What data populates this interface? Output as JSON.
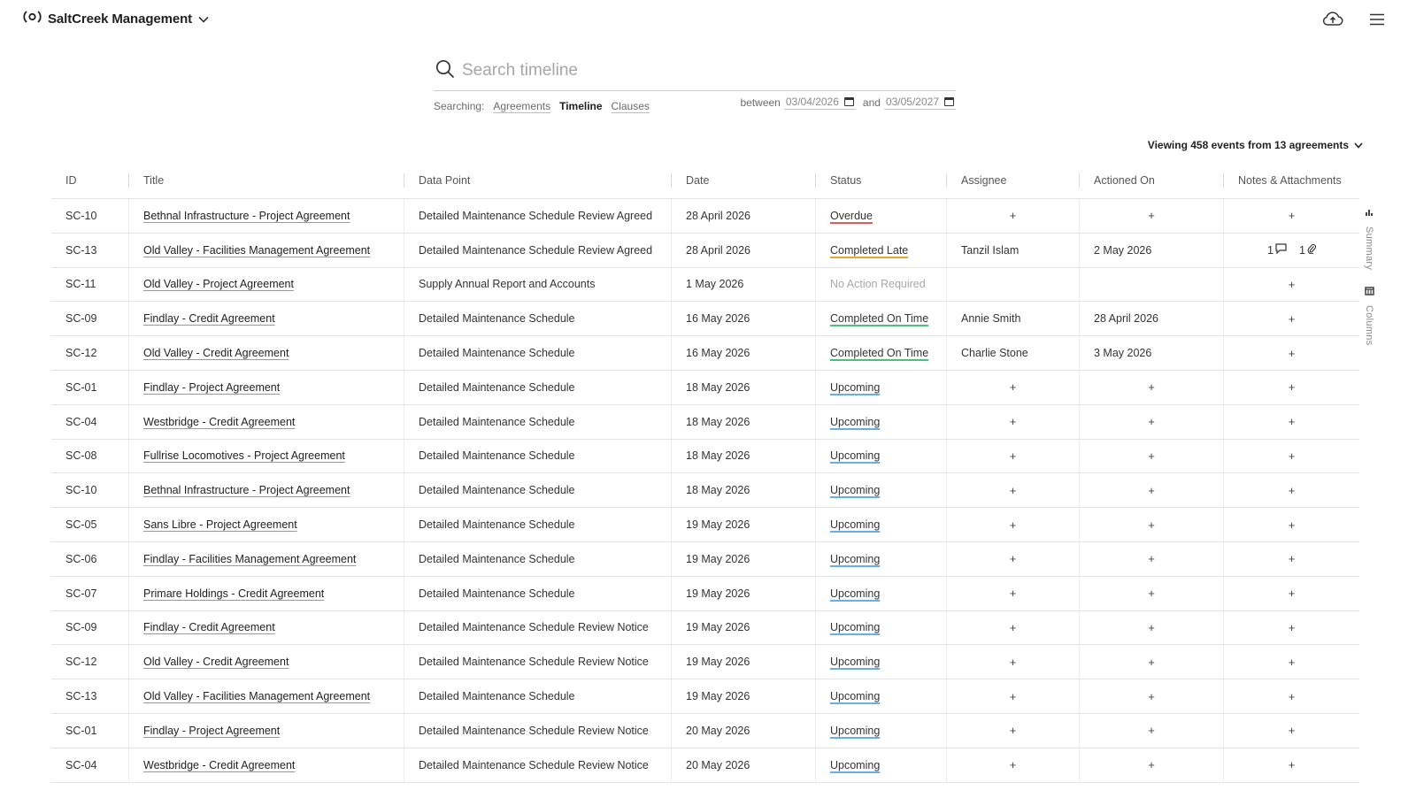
{
  "header": {
    "org_name": "SaltCreek Management",
    "icons": {
      "logo": "brand-logo-icon",
      "switch": "chevron-down-icon",
      "upload": "cloud-upload-icon",
      "menu": "hamburger-menu-icon"
    }
  },
  "search": {
    "placeholder": "Search timeline",
    "searching_label": "Searching:",
    "scopes": [
      "Agreements",
      "Timeline",
      "Clauses"
    ],
    "active_scope": "Timeline",
    "between_label": "between",
    "and_label": "and",
    "start_date": "03/04/2026",
    "end_date": "03/05/2027"
  },
  "summary": {
    "viewing_text": "Viewing 458 events from 13 agreements"
  },
  "table": {
    "columns": [
      "ID",
      "Title",
      "Data Point",
      "Date",
      "Status",
      "Assignee",
      "Actioned On",
      "Notes & Attachments"
    ],
    "rows": [
      {
        "id": "SC-10",
        "title": "Bethnal Infrastructure - Project Agreement",
        "data_point": "Detailed Maintenance Schedule Review Agreed",
        "date": "28 April 2026",
        "status": "Overdue",
        "assignee": "+",
        "actioned_on": "+",
        "notes": "+"
      },
      {
        "id": "SC-13",
        "title": "Old Valley - Facilities Management Agreement",
        "data_point": "Detailed Maintenance Schedule Review Agreed",
        "date": "28 April 2026",
        "status": "Completed Late",
        "assignee": "Tanzil Islam",
        "actioned_on": "2 May 2026",
        "notes": "",
        "notes_comments": "1",
        "notes_attachments": "1"
      },
      {
        "id": "SC-11",
        "title": "Old Valley - Project Agreement",
        "data_point": "Supply Annual Report and Accounts",
        "date": "1 May 2026",
        "status": "No Action Required",
        "assignee": "",
        "actioned_on": "",
        "notes": "+"
      },
      {
        "id": "SC-09",
        "title": "Findlay - Credit Agreement",
        "data_point": "Detailed Maintenance Schedule",
        "date": "16 May 2026",
        "status": "Completed On Time",
        "assignee": "Annie Smith",
        "actioned_on": "28 April 2026",
        "notes": "+"
      },
      {
        "id": "SC-12",
        "title": "Old Valley - Credit Agreement",
        "data_point": "Detailed Maintenance Schedule",
        "date": "16 May 2026",
        "status": "Completed On Time",
        "assignee": "Charlie Stone",
        "actioned_on": "3 May 2026",
        "notes": "+"
      },
      {
        "id": "SC-01",
        "title": "Findlay - Project Agreement",
        "data_point": "Detailed Maintenance Schedule",
        "date": "18 May 2026",
        "status": "Upcoming",
        "assignee": "+",
        "actioned_on": "+",
        "notes": "+"
      },
      {
        "id": "SC-04",
        "title": "Westbridge - Credit Agreement",
        "data_point": "Detailed Maintenance Schedule",
        "date": "18 May 2026",
        "status": "Upcoming",
        "assignee": "+",
        "actioned_on": "+",
        "notes": "+"
      },
      {
        "id": "SC-08",
        "title": "Fullrise Locomotives - Project Agreement",
        "data_point": "Detailed Maintenance Schedule",
        "date": "18 May 2026",
        "status": "Upcoming",
        "assignee": "+",
        "actioned_on": "+",
        "notes": "+"
      },
      {
        "id": "SC-10",
        "title": "Bethnal Infrastructure - Project Agreement",
        "data_point": "Detailed Maintenance Schedule",
        "date": "18 May 2026",
        "status": "Upcoming",
        "assignee": "+",
        "actioned_on": "+",
        "notes": "+"
      },
      {
        "id": "SC-05",
        "title": "Sans Libre - Project Agreement",
        "data_point": "Detailed Maintenance Schedule",
        "date": "19 May 2026",
        "status": "Upcoming",
        "assignee": "+",
        "actioned_on": "+",
        "notes": "+"
      },
      {
        "id": "SC-06",
        "title": "Findlay - Facilities Management Agreement",
        "data_point": "Detailed Maintenance Schedule",
        "date": "19 May 2026",
        "status": "Upcoming",
        "assignee": "+",
        "actioned_on": "+",
        "notes": "+"
      },
      {
        "id": "SC-07",
        "title": "Primare Holdings - Credit Agreement",
        "data_point": "Detailed Maintenance Schedule",
        "date": "19 May 2026",
        "status": "Upcoming",
        "assignee": "+",
        "actioned_on": "+",
        "notes": "+"
      },
      {
        "id": "SC-09",
        "title": "Findlay - Credit Agreement",
        "data_point": "Detailed Maintenance Schedule Review Notice",
        "date": "19 May 2026",
        "status": "Upcoming",
        "assignee": "+",
        "actioned_on": "+",
        "notes": "+"
      },
      {
        "id": "SC-12",
        "title": "Old Valley - Credit Agreement",
        "data_point": "Detailed Maintenance Schedule Review Notice",
        "date": "19 May 2026",
        "status": "Upcoming",
        "assignee": "+",
        "actioned_on": "+",
        "notes": "+"
      },
      {
        "id": "SC-13",
        "title": "Old Valley - Facilities Management Agreement",
        "data_point": "Detailed Maintenance Schedule",
        "date": "19 May 2026",
        "status": "Upcoming",
        "assignee": "+",
        "actioned_on": "+",
        "notes": "+"
      },
      {
        "id": "SC-01",
        "title": "Findlay - Project Agreement",
        "data_point": "Detailed Maintenance Schedule Review Notice",
        "date": "20 May 2026",
        "status": "Upcoming",
        "assignee": "+",
        "actioned_on": "+",
        "notes": "+"
      },
      {
        "id": "SC-04",
        "title": "Westbridge - Credit Agreement",
        "data_point": "Detailed Maintenance Schedule Review Notice",
        "date": "20 May 2026",
        "status": "Upcoming",
        "assignee": "+",
        "actioned_on": "+",
        "notes": "+"
      }
    ]
  },
  "rail": {
    "items": [
      {
        "label": "Summary",
        "icon": "bar-chart-icon"
      },
      {
        "label": "Columns",
        "icon": "columns-icon"
      }
    ]
  },
  "colors": {
    "overdue": "#e05c5c",
    "completed_late": "#e8a53a",
    "completed_on_time": "#4fbf7f",
    "upcoming": "#6aaee8",
    "no_action": "#a8a8a8"
  }
}
